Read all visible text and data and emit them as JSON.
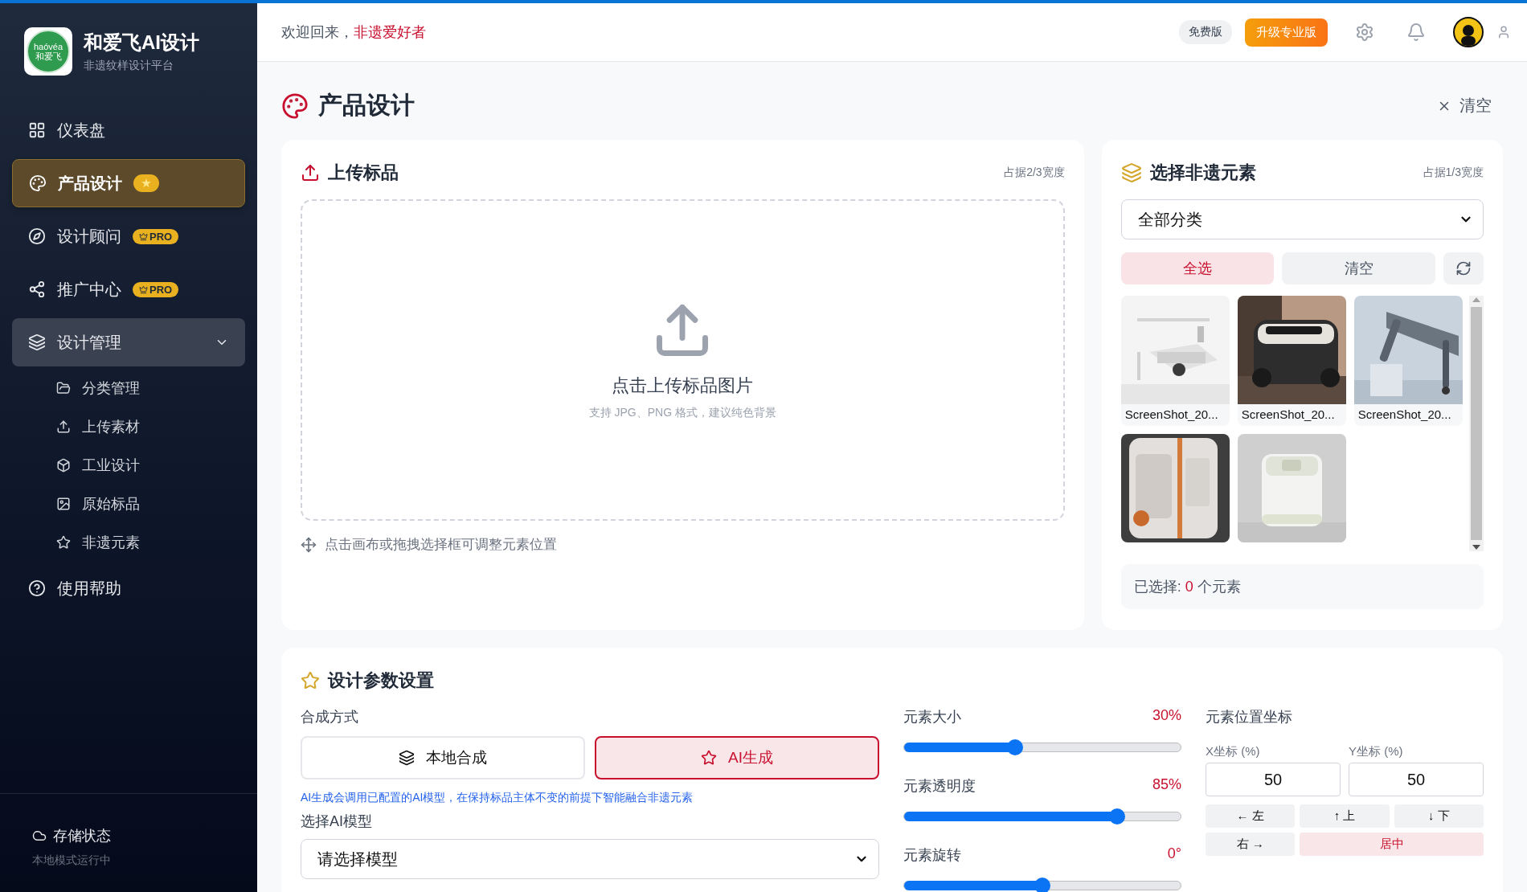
{
  "brand": {
    "name": "和爱飞AI设计",
    "subtitle": "非遗纹样设计平台",
    "logo_text": "haóvéa",
    "logo_sub": "和爱飞"
  },
  "nav": [
    {
      "label": "仪表盘",
      "selected": false
    },
    {
      "label": "产品设计",
      "selected": true,
      "badge": {
        "kind": "icon",
        "text": "★"
      }
    },
    {
      "label": "设计顾问",
      "selected": false,
      "badge": {
        "kind": "pro",
        "text": "PRO"
      }
    },
    {
      "label": "推广中心",
      "selected": false,
      "badge": {
        "kind": "pro",
        "text": "PRO"
      }
    },
    {
      "label": "设计管理",
      "selected": false,
      "expanded": true,
      "children": [
        {
          "label": "分类管理",
          "selected": false
        },
        {
          "label": "上传素材",
          "selected": false
        },
        {
          "label": "工业设计",
          "selected": false
        },
        {
          "label": "原始标品",
          "selected": false
        },
        {
          "label": "非遗元素",
          "selected": false
        }
      ]
    },
    {
      "label": "使用帮助",
      "selected": false
    }
  ],
  "storage": {
    "title": "存储状态",
    "detail": "本地模式运行中"
  },
  "header": {
    "greeting": "欢迎回来，",
    "user": "非遗爱好者",
    "plan": "免费版",
    "upgrade": "升级专业版"
  },
  "page": {
    "title": "产品设计",
    "clear": "清空"
  },
  "upload": {
    "title": "上传标品",
    "width_note": "占据2/3宽度",
    "prompt": "点击上传标品图片",
    "hint": "支持 JPG、PNG 格式，建议纯色背景",
    "tip": "点击画布或拖拽选择框可调整元素位置"
  },
  "elements": {
    "title": "选择非遗元素",
    "width_note": "占据1/3宽度",
    "category": "全部分类",
    "select_all": "全选",
    "clear": "清空",
    "items": [
      {
        "kind": "picture",
        "caption": "ScreenShot_20..."
      },
      {
        "kind": "picture",
        "caption": "ScreenShot_20..."
      },
      {
        "kind": "picture",
        "caption": "ScreenShot_20..."
      },
      {
        "kind": "picture"
      },
      {
        "kind": "picture"
      }
    ],
    "selected_label": "已选择: ",
    "selected_count": "0",
    "selected_unit": " 个元素"
  },
  "params": {
    "title": "设计参数设置",
    "mode_label": "合成方式",
    "modes": [
      {
        "label": "本地合成",
        "selected": false
      },
      {
        "label": "AI生成",
        "selected": true
      }
    ],
    "mode_note": "AI生成会调用已配置的AI模型，在保持标品主体不变的前提下智能融合非遗元素",
    "model_label": "选择AI模型",
    "model_placeholder": "请选择模型",
    "sliders": [
      {
        "label": "元素大小",
        "reading": "30%",
        "level": 0.4
      },
      {
        "label": "元素透明度",
        "reading": "85%",
        "level": 0.77
      },
      {
        "label": "元素旋转",
        "reading": "0°",
        "level": 0.5
      }
    ],
    "position": {
      "title": "元素位置坐标",
      "fields": [
        {
          "label": "X坐标 (%)",
          "value": "50"
        },
        {
          "label": "Y坐标 (%)",
          "value": "50"
        }
      ],
      "buttons": [
        {
          "label": "← 左",
          "kind": "move"
        },
        {
          "label": "↑ 上",
          "kind": "move"
        },
        {
          "label": "↓ 下",
          "kind": "move"
        },
        {
          "label": "右 →",
          "kind": "move"
        },
        {
          "label": "居中",
          "kind": "center"
        }
      ]
    }
  }
}
